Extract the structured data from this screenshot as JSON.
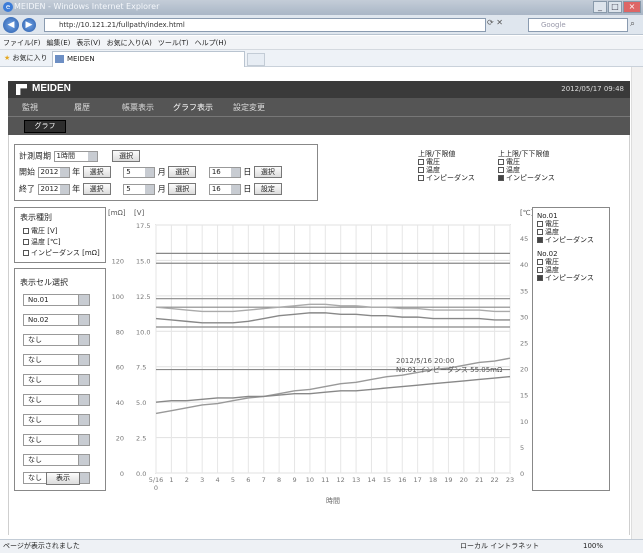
{
  "window": {
    "title": "MEIDEN - Windows Internet Explorer"
  },
  "address": {
    "url": "http://10.121.21/fullpath/index.html",
    "search_placeholder": "Google"
  },
  "menu": [
    "ファイル(F)",
    "編集(E)",
    "表示(V)",
    "お気に入り(A)",
    "ツール(T)",
    "ヘルプ(H)"
  ],
  "favorites": {
    "label": "お気に入り",
    "tab_title": "MEIDEN"
  },
  "app": {
    "brand": "MEIDEN",
    "datetime": "2012/05/17 09:48",
    "nav": [
      "監視",
      "履歴",
      "帳票表示",
      "グラフ表示",
      "設定変更"
    ],
    "subtab": "グラフ"
  },
  "controls": {
    "period_label": "計測周期",
    "period_value": "1時間",
    "select": "選択",
    "start_label": "開始",
    "end_label": "終了",
    "year": "2012",
    "year_unit": "年",
    "month": "5",
    "month_unit": "月",
    "day": "16",
    "day_unit": "日",
    "set": "設定"
  },
  "limits_legend": {
    "left_title": "上限/下限値",
    "left_items": [
      "電圧",
      "温度",
      "インピーダンス"
    ],
    "right_title": "上上限/下下限値",
    "right_items": [
      "電圧",
      "温度",
      "インピーダンス"
    ]
  },
  "display_type": {
    "title": "表示種別",
    "items": [
      "電圧 [V]",
      "温度 [℃]",
      "インピーダンス [mΩ]"
    ]
  },
  "cell_select": {
    "title": "表示セル選択",
    "cells": [
      "No.01",
      "No.02",
      "なし",
      "なし",
      "なし",
      "なし",
      "なし",
      "なし",
      "なし",
      "なし"
    ],
    "show_button": "表示"
  },
  "right_legend": {
    "groups": [
      {
        "name": "No.01",
        "items": [
          "電圧",
          "温度",
          "インピーダンス"
        ]
      },
      {
        "name": "No.02",
        "items": [
          "電圧",
          "温度",
          "インピーダンス"
        ]
      }
    ]
  },
  "chart_data": {
    "type": "line",
    "units": {
      "left1": "[mΩ]",
      "left2": "[V]",
      "right": "[℃]"
    },
    "mohm_ticks": [
      0,
      20,
      40,
      60,
      80,
      100,
      120
    ],
    "v_ticks": [
      "0.0",
      "2.5",
      "5.0",
      "7.5",
      "10.0",
      "12.5",
      "15.0",
      "17.5"
    ],
    "c_ticks": [
      0,
      5,
      10,
      15,
      20,
      25,
      30,
      35,
      40,
      45
    ],
    "x_ticks": [
      "5/16\n0",
      "1",
      "2",
      "3",
      "4",
      "5",
      "6",
      "7",
      "8",
      "9",
      "10",
      "11",
      "12",
      "13",
      "14",
      "15",
      "16",
      "17",
      "18",
      "19",
      "20",
      "21",
      "22",
      "23"
    ],
    "xlabel": "時間",
    "v_ylim": [
      0,
      17.5
    ],
    "x": [
      0,
      1,
      2,
      3,
      4,
      5,
      6,
      7,
      8,
      9,
      10,
      11,
      12,
      13,
      14,
      15,
      16,
      17,
      18,
      19,
      20,
      21,
      22,
      23
    ],
    "reference_lines_v": [
      15.5,
      14.8,
      12.3,
      11.7,
      10.3,
      7.3
    ],
    "series": [
      {
        "values": [
          10.9,
          10.8,
          10.7,
          10.6,
          10.6,
          10.6,
          10.7,
          10.9,
          11.1,
          11.2,
          11.3,
          11.3,
          11.2,
          11.2,
          11.1,
          11.1,
          11.0,
          11.0,
          10.9,
          10.9,
          10.9,
          10.9,
          10.8,
          10.8
        ]
      },
      {
        "values": [
          11.7,
          11.6,
          11.5,
          11.4,
          11.4,
          11.4,
          11.5,
          11.6,
          11.7,
          11.8,
          11.9,
          11.9,
          11.8,
          11.8,
          11.7,
          11.7,
          11.6,
          11.6,
          11.5,
          11.5,
          11.5,
          11.5,
          11.4,
          11.4
        ]
      },
      {
        "values": [
          4.2,
          4.4,
          4.6,
          4.8,
          4.9,
          5.1,
          5.3,
          5.4,
          5.6,
          5.8,
          5.9,
          6.1,
          6.3,
          6.4,
          6.6,
          6.8,
          6.9,
          7.1,
          7.3,
          7.4,
          7.6,
          7.8,
          7.9,
          8.1
        ]
      },
      {
        "values": [
          5.0,
          5.1,
          5.1,
          5.2,
          5.3,
          5.3,
          5.4,
          5.4,
          5.5,
          5.6,
          5.6,
          5.7,
          5.8,
          5.8,
          5.9,
          6.0,
          6.1,
          6.2,
          6.3,
          6.4,
          6.5,
          6.6,
          6.7,
          6.8
        ]
      }
    ],
    "tooltip": [
      "2012/5/16 20:00",
      "No.01-インピーダンス 55.05mΩ"
    ]
  },
  "status": {
    "left": "ページが表示されました",
    "zone": "ローカル イントラネット",
    "zoom": "100%"
  }
}
